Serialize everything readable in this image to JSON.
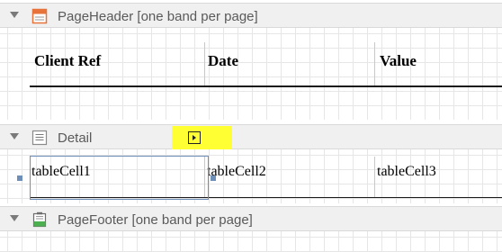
{
  "bands": {
    "page_header": {
      "title": "PageHeader [one band per page]",
      "icon": "page-header-band-icon"
    },
    "detail": {
      "title": "Detail",
      "icon": "detail-band-icon",
      "smart_tag_icon": "smart-tag-arrow-icon"
    },
    "page_footer": {
      "title": "PageFooter [one band per page]",
      "icon": "page-footer-band-icon"
    }
  },
  "header_table": {
    "cells": [
      "Client Ref",
      "Date",
      "Value"
    ]
  },
  "detail_table": {
    "cells": [
      "tableCell1",
      "tableCell2",
      "tableCell3"
    ]
  },
  "colors": {
    "band_background": "#f0f0f0",
    "smart_tag": "#ffff33",
    "selection": "#6d8fb8",
    "header_icon_accent": "#e8733a",
    "footer_icon_accent": "#4caf50"
  }
}
